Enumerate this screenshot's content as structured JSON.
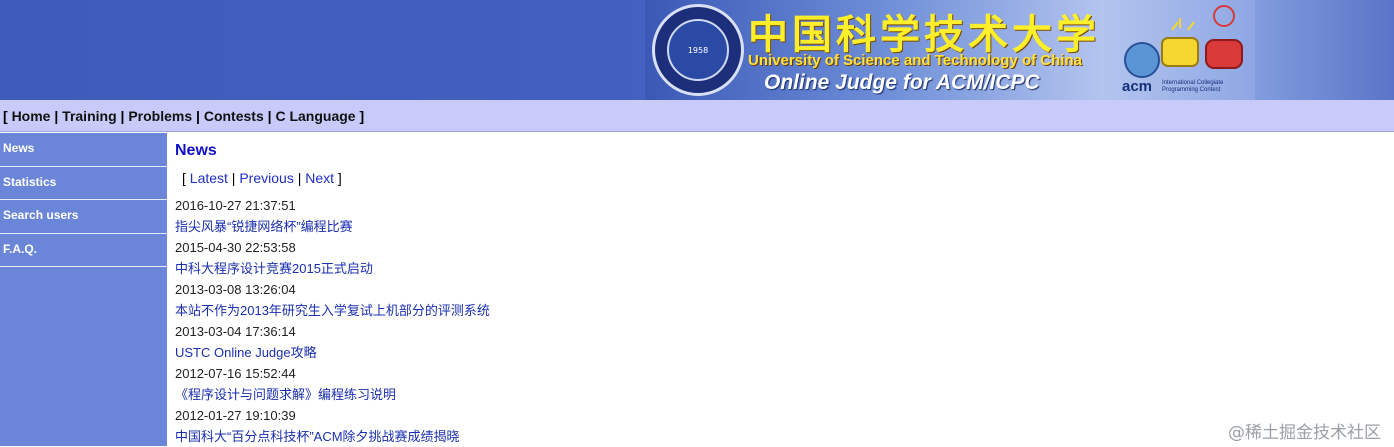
{
  "header": {
    "seal_year": "1958",
    "cn_title": "中国科学技术大学",
    "university_name": "University of Science and Technology of China",
    "oj_title": "Online Judge for ACM/ICPC",
    "acm_text": "acm",
    "acm_sub": "International Collegiate Programming Contest"
  },
  "nav": {
    "open": "[ ",
    "items": [
      "Home",
      "Training",
      "Problems",
      "Contests",
      "C Language"
    ],
    "sep": " | ",
    "close": " ]"
  },
  "sidebar": {
    "items": [
      {
        "label": "News"
      },
      {
        "label": "Statistics"
      },
      {
        "label": "Search users"
      },
      {
        "label": "F.A.Q."
      }
    ]
  },
  "main": {
    "title": "News",
    "pager": {
      "open": "[ ",
      "latest": "Latest",
      "previous": "Previous",
      "next": "Next",
      "sep": " | ",
      "close": " ]"
    },
    "news": [
      {
        "date": "2016-10-27 21:37:51",
        "title": "指尖风暴“锐捷网络杯”编程比赛"
      },
      {
        "date": "2015-04-30 22:53:58",
        "title": "中科大程序设计竞赛2015正式启动"
      },
      {
        "date": "2013-03-08 13:26:04",
        "title": "本站不作为2013年研究生入学复试上机部分的评测系统"
      },
      {
        "date": "2013-03-04 17:36:14",
        "title": "USTC Online Judge攻略"
      },
      {
        "date": "2012-07-16 15:52:44",
        "title": "《程序设计与问题求解》编程练习说明"
      },
      {
        "date": "2012-01-27 19:10:39",
        "title": "中国科大“百分点科技杯”ACM除夕挑战赛成绩揭晓"
      }
    ]
  },
  "watermark": "@稀土掘金技术社区"
}
